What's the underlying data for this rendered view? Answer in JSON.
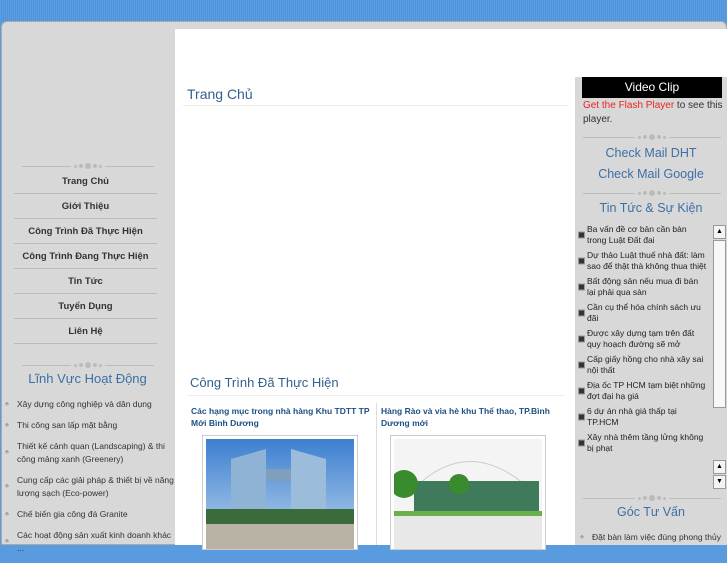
{
  "left": {
    "nav": [
      "Trang Chủ",
      "Giới Thiệu",
      "Công Trình Đã Thực Hiện",
      "Công Trình Đang Thực Hiện",
      "Tin Tức",
      "Tuyển Dụng",
      "Liên Hệ"
    ],
    "fields_title": "Lĩnh Vực Hoạt Động",
    "fields": [
      "Xây dựng công nghiệp và dân dụng",
      "Thi công san lấp mặt bằng",
      "Thiết kế cảnh quan (Landscaping) & thi công mảng xanh (Greenery)",
      "Cung cấp các giải pháp & thiết bị về năng lượng sạch (Eco-power)",
      "Chế biến gia công đá Granite",
      "Các hoạt động sản xuất kinh doanh khác ..."
    ]
  },
  "main": {
    "title": "Trang Chủ",
    "projects_title": "Công Trình Đã Thực Hiện",
    "projects": [
      {
        "title": "Các hạng mục trong nhà hàng Khu TDTT TP Mới Bình Dương"
      },
      {
        "title": "Hàng Rào và vỉa hè khu Thể thao, TP.Bình Dương mới"
      }
    ]
  },
  "right": {
    "video_title": "Video Clip",
    "flash_link": "Get the Flash Player",
    "flash_text": " to see this player.",
    "mail_dht": "Check Mail DHT",
    "mail_google": "Check Mail Google",
    "news_title": "Tin Tức & Sự Kiện",
    "news": [
      "Ba vấn đề cơ bản cần bàn trong Luật Đất đai",
      "Dự thảo Luật thuế nhà đất: làm sao để thật thà không thua thiệt",
      "Bất động sản nếu mua đi bán lại phải qua sàn",
      "Cần cụ thể hóa chính sách ưu đãi",
      "Được xây dựng tạm trên đất quy hoạch đường sẽ mở",
      "Cấp giấy hồng cho nhà xây sai nội thất",
      "Địa ốc TP HCM tạm biệt những đợt đại hạ giá",
      "6 dự án nhà giá thấp tại TP.HCM",
      "Xây nhà thêm tầng lửng không bị phạt"
    ],
    "advice_title": "Góc Tư Vấn",
    "advice": [
      "Đặt bàn làm việc đúng phong thủy"
    ]
  }
}
